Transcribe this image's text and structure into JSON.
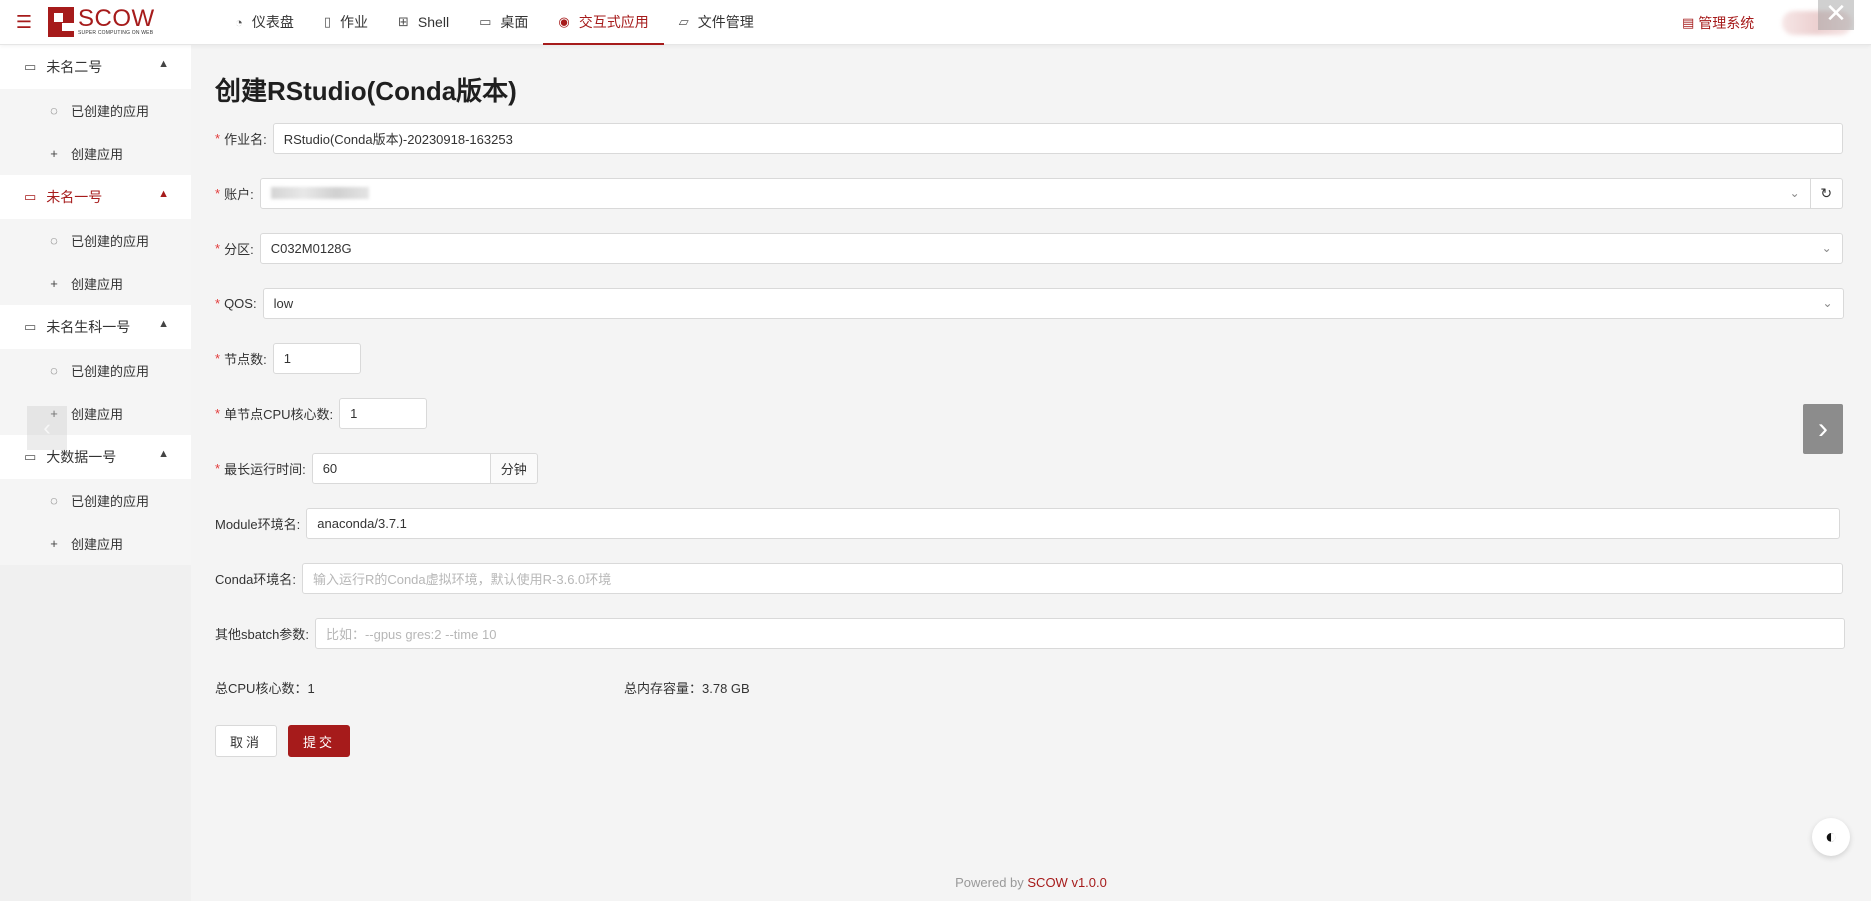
{
  "header": {
    "logo_title": "SCOW",
    "logo_sub": "SUPER COMPUTING ON WEB",
    "nav": [
      {
        "label": "仪表盘",
        "icon": "dashboard-icon"
      },
      {
        "label": "作业",
        "icon": "file-icon"
      },
      {
        "label": "Shell",
        "icon": "terminal-icon"
      },
      {
        "label": "桌面",
        "icon": "desktop-icon"
      },
      {
        "label": "交互式应用",
        "icon": "eye-icon"
      },
      {
        "label": "文件管理",
        "icon": "folder-icon"
      }
    ],
    "admin_label": "管理系统"
  },
  "sidebar": {
    "groups": [
      {
        "label": "未名二号",
        "items": [
          "已创建的应用",
          "创建应用"
        ]
      },
      {
        "label": "未名一号",
        "items": [
          "已创建的应用",
          "创建应用"
        ]
      },
      {
        "label": "未名生科一号",
        "items": [
          "已创建的应用",
          "创建应用"
        ]
      },
      {
        "label": "大数据一号",
        "items": [
          "已创建的应用",
          "创建应用"
        ]
      }
    ]
  },
  "form": {
    "title": "创建RStudio(Conda版本)",
    "job_name_label": "作业名",
    "job_name_value": "RStudio(Conda版本)-20230918-163253",
    "account_label": "账户",
    "partition_label": "分区",
    "partition_value": "C032M0128G",
    "qos_label": "QOS",
    "qos_value": "low",
    "nodes_label": "节点数",
    "nodes_value": "1",
    "cpu_label": "单节点CPU核心数",
    "cpu_value": "1",
    "time_label": "最长运行时间",
    "time_value": "60",
    "time_unit": "分钟",
    "module_label": "Module环境名",
    "module_value": "anaconda/3.7.1",
    "conda_label": "Conda环境名",
    "conda_placeholder": "输入运行R的Conda虚拟环境，默认使用R-3.6.0环境",
    "sbatch_label": "其他sbatch参数",
    "sbatch_placeholder": "比如：--gpus gres:2 --time 10",
    "total_cpu_label": "总CPU核心数：",
    "total_cpu_value": "1",
    "total_mem_label": "总内存容量：",
    "total_mem_value": "3.78 GB",
    "cancel_label": "取消",
    "submit_label": "提交"
  },
  "footer": {
    "prefix": "Powered by ",
    "version": "SCOW v1.0.0"
  },
  "colors": {
    "accent": "#a61b1b",
    "required": "#e23a3a"
  }
}
